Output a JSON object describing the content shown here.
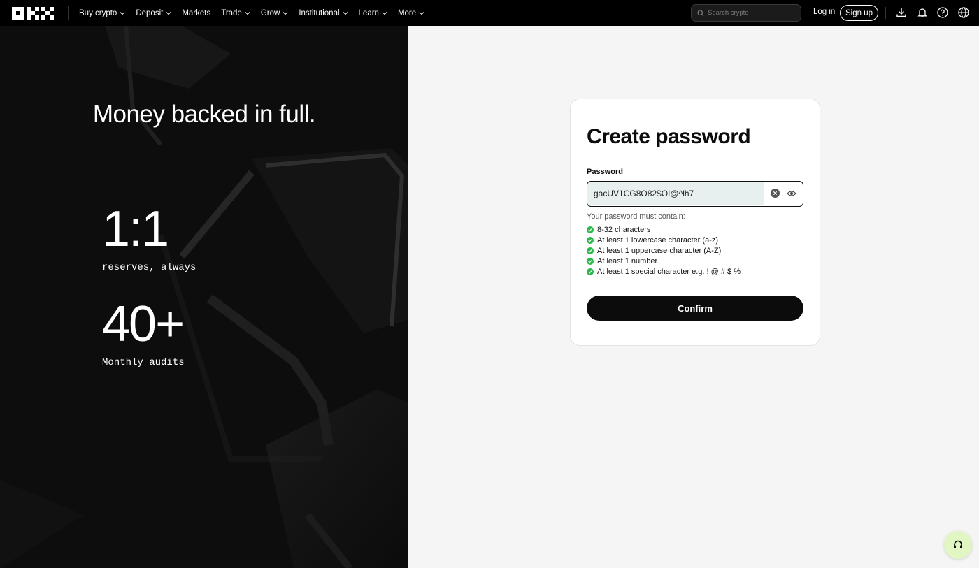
{
  "brand": {
    "logo_icon": "okx-logo-icon"
  },
  "nav": {
    "items": [
      {
        "label": "Buy crypto",
        "has_dropdown": true
      },
      {
        "label": "Deposit",
        "has_dropdown": true
      },
      {
        "label": "Markets",
        "has_dropdown": false
      },
      {
        "label": "Trade",
        "has_dropdown": true
      },
      {
        "label": "Grow",
        "has_dropdown": true
      },
      {
        "label": "Institutional",
        "has_dropdown": true
      },
      {
        "label": "Learn",
        "has_dropdown": true
      },
      {
        "label": "More",
        "has_dropdown": true
      }
    ],
    "search_placeholder": "Search crypto",
    "login_label": "Log in",
    "signup_label": "Sign up",
    "icons": [
      "download-icon",
      "bell-icon",
      "help-icon",
      "globe-icon"
    ]
  },
  "hero": {
    "title": "Money backed in full.",
    "stat1_value": "1:1",
    "stat1_label": "reserves, always",
    "stat2_value": "40+",
    "stat2_label": "Monthly audits"
  },
  "form": {
    "title": "Create password",
    "password_label": "Password",
    "password_value": "gacUV1CG8O82$OI@^lh7",
    "rules_heading": "Your password must contain:",
    "rules": [
      {
        "text": "8-32 characters",
        "met": true
      },
      {
        "text": "At least 1 lowercase character (a-z)",
        "met": true
      },
      {
        "text": "At least 1 uppercase character (A-Z)",
        "met": true
      },
      {
        "text": "At least 1 number",
        "met": true
      },
      {
        "text": "At least 1 special character e.g. ! @ # $ %",
        "met": true
      }
    ],
    "confirm_label": "Confirm"
  },
  "colors": {
    "check": "#2db84c",
    "support_bg": "#e2f6c4",
    "button": "#0c0c0c"
  }
}
